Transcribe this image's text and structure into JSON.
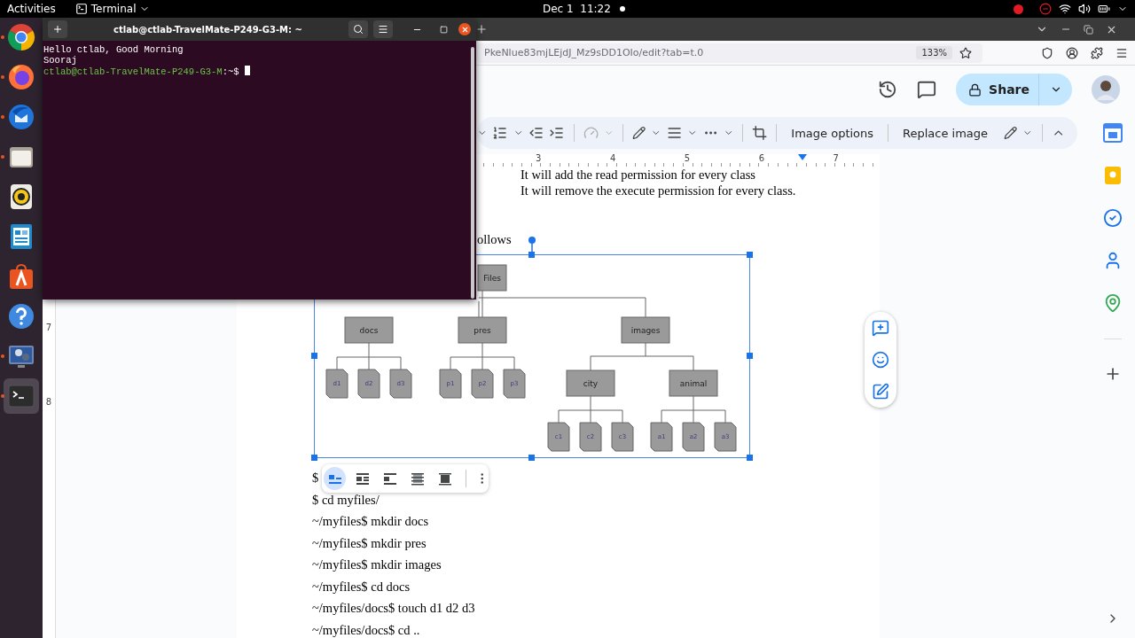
{
  "top_bar": {
    "activities": "Activities",
    "app_menu": "Terminal",
    "clock": "Dec 1  11:22"
  },
  "dock": {
    "items": [
      {
        "kind": "chrome",
        "running": true,
        "selected": false
      },
      {
        "kind": "firefox",
        "running": true,
        "selected": false
      },
      {
        "kind": "thunderbird",
        "running": true,
        "selected": false
      },
      {
        "kind": "files",
        "running": true,
        "selected": false
      },
      {
        "kind": "rhythmbox",
        "running": false,
        "selected": false
      },
      {
        "kind": "writer",
        "running": false,
        "selected": false
      },
      {
        "kind": "software",
        "running": false,
        "selected": false
      },
      {
        "kind": "help",
        "running": false,
        "selected": false
      },
      {
        "kind": "video",
        "running": true,
        "selected": false
      },
      {
        "kind": "terminal",
        "running": true,
        "selected": true
      }
    ]
  },
  "terminal": {
    "title": "ctlab@ctlab-TravelMate-P249-G3-M: ~",
    "output": [
      "Hello ctlab, Good Morning",
      "Sooraj"
    ],
    "prompt_user": "ctlab@ctlab-TravelMate-P249-G3-M",
    "prompt_path": ":~$"
  },
  "browser": {
    "url": "PkeNlue83mjLEjdJ_Mz9sDD1OIo/edit?tab=t.0",
    "zoom": "133%"
  },
  "docs": {
    "share": "Share",
    "toolbar_buttons": [
      "Image options",
      "Replace image"
    ],
    "ruler_marks": [
      "3",
      "4",
      "5",
      "6",
      "7"
    ],
    "side_ruler_marks": [
      "7",
      "8"
    ],
    "lines_top": [
      "It will add the read permission for every class",
      "It will remove the execute permission for every class."
    ],
    "caption_fragment": "ollows",
    "diagram": {
      "name": "Files",
      "children": [
        {
          "name": "docs",
          "children": [
            {
              "name": "d1"
            },
            {
              "name": "d2"
            },
            {
              "name": "d3"
            }
          ]
        },
        {
          "name": "pres",
          "children": [
            {
              "name": "p1"
            },
            {
              "name": "p2"
            },
            {
              "name": "p3"
            }
          ]
        },
        {
          "name": "images",
          "children": [
            {
              "name": "city",
              "children": [
                {
                  "name": "c1"
                },
                {
                  "name": "c2"
                },
                {
                  "name": "c3"
                }
              ]
            },
            {
              "name": "animal",
              "children": [
                {
                  "name": "a1"
                },
                {
                  "name": "a2"
                },
                {
                  "name": "a3"
                }
              ]
            }
          ]
        }
      ]
    },
    "wrap_options": [
      {
        "kind": "inline",
        "selected": true
      },
      {
        "kind": "wrap",
        "selected": false
      },
      {
        "kind": "break",
        "selected": false
      },
      {
        "kind": "behind",
        "selected": false
      },
      {
        "kind": "front",
        "selected": false
      }
    ],
    "commands": [
      "$",
      "$ cd myfiles/",
      "~/myfiles$ mkdir docs",
      "~/myfiles$ mkdir pres",
      "~/myfiles$ mkdir images",
      "~/myfiles$ cd docs",
      "~/myfiles/docs$ touch d1 d2 d3",
      "~/myfiles/docs$ cd .."
    ]
  }
}
